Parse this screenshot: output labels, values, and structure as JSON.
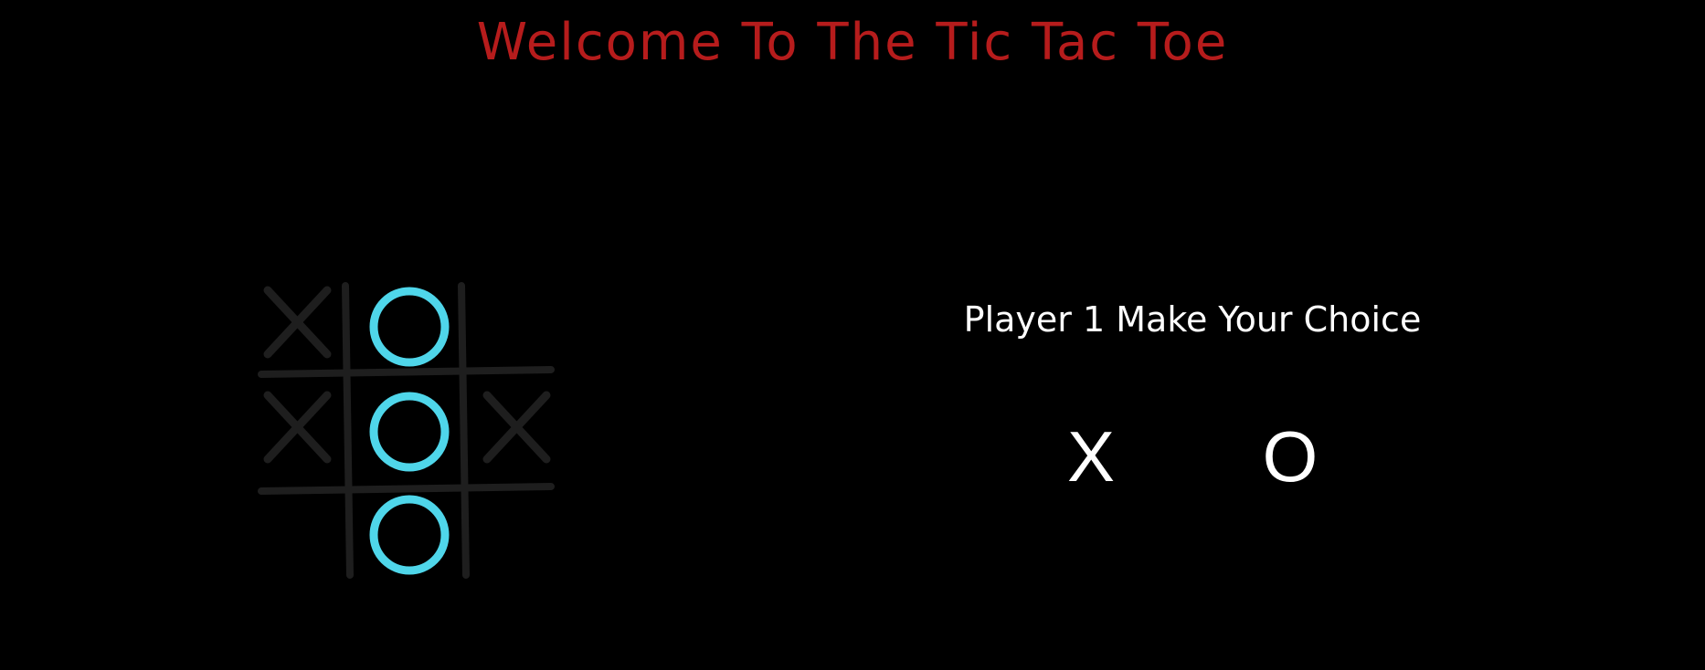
{
  "title": "Welcome To The Tic Tac Toe",
  "colors": {
    "background": "#000000",
    "title": "#b61c1c",
    "grid": "#1e1e1e",
    "faded_x": "#1e1e1e",
    "o_mark": "#4fd6ea",
    "text": "#ffffff"
  },
  "board": {
    "cells": [
      "X",
      "O",
      "",
      "X",
      "O",
      "X",
      "",
      "O",
      ""
    ]
  },
  "prompt": "Player 1 Make Your Choice",
  "choices": {
    "x_label": "X",
    "o_label": "O"
  }
}
